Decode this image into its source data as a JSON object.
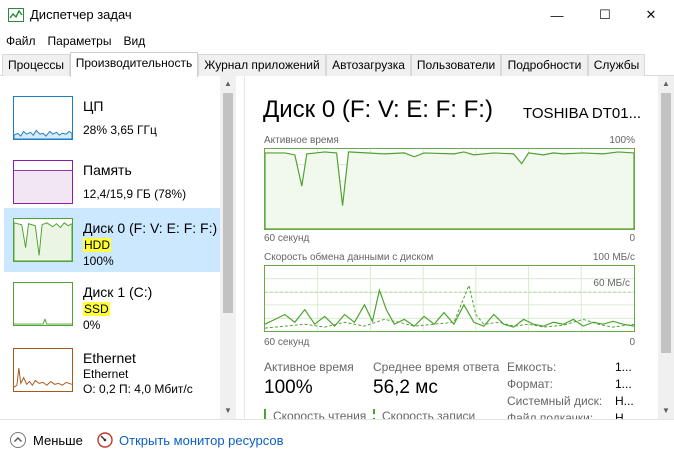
{
  "window": {
    "title": "Диспетчер задач",
    "min_glyph": "—",
    "max_glyph": "☐",
    "close_glyph": "✕"
  },
  "menu": [
    "Файл",
    "Параметры",
    "Вид"
  ],
  "tabs": [
    "Процессы",
    "Производительность",
    "Журнал приложений",
    "Автозагрузка",
    "Пользователи",
    "Подробности",
    "Службы"
  ],
  "active_tab": "Производительность",
  "sidebar": {
    "items": [
      {
        "name": "ЦП",
        "sub": "28% 3,65 ГГц",
        "color": "#1a7dc8"
      },
      {
        "name": "Память",
        "sub": "12,4/15,9 ГБ (78%)",
        "color": "#8b1ea8"
      },
      {
        "name": "Диск 0 (F: V: E: F: F:)",
        "type": "HDD",
        "value": "100%",
        "color": "#4da32f"
      },
      {
        "name": "Диск 1 (C:)",
        "type": "SSD",
        "value": "0%",
        "color": "#4da32f"
      },
      {
        "name": "Ethernet",
        "adapter": "Ethernet",
        "speed": "О: 0,2 П: 4,0 Мбит/с",
        "color": "#a8581c"
      }
    ]
  },
  "main": {
    "title": "Диск 0 (F: V: E: F: F:)",
    "model": "TOSHIBA DT01...",
    "graph1": {
      "label": "Активное время",
      "max": "100%",
      "left": "60 секунд",
      "right": "0"
    },
    "graph2": {
      "label": "Скорость обмена данными с диском",
      "max": "100 МБ/с",
      "inner": "60 МБ/с",
      "left": "60 секунд",
      "right": "0"
    },
    "stats": {
      "active_label": "Активное время",
      "active_value": "100%",
      "resp_label": "Среднее время ответа",
      "resp_value": "56,2 мс",
      "read_label": "Скорость чтения",
      "write_label": "Скорость записи"
    },
    "props": [
      {
        "label": "Емкость:",
        "value": "1..."
      },
      {
        "label": "Формат:",
        "value": "1..."
      },
      {
        "label": "Системный диск:",
        "value": "Н..."
      },
      {
        "label": "Файл подкачки:",
        "value": "Н..."
      }
    ]
  },
  "bottom": {
    "less_label": "Меньше",
    "monitor_link": "Открыть монитор ресурсов"
  }
}
